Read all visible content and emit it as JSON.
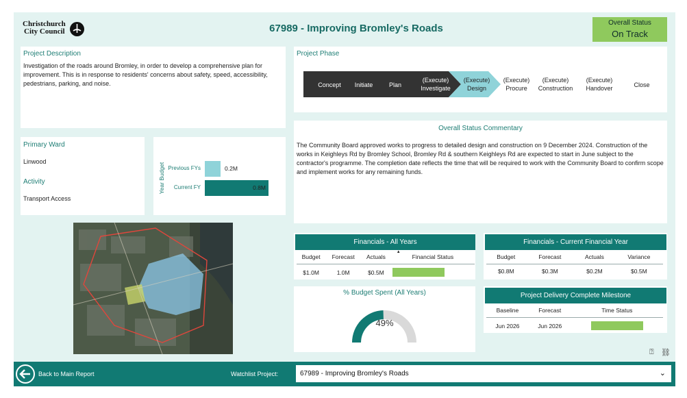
{
  "header": {
    "title": "67989 - Improving Bromley's Roads",
    "logo_line1": "Christchurch",
    "logo_line2": "City Council",
    "overall_status_label": "Overall Status",
    "overall_status_value": "On Track"
  },
  "description": {
    "label": "Project Description",
    "text": "Investigation of the roads around Bromley, in order to develop a comprehensive plan for improvement. This is in response to residents' concerns about safety, speed, accessibility, pedestrians, parking, and noise."
  },
  "phase": {
    "label": "Project Phase",
    "steps": [
      {
        "l1": "Concept",
        "l2": ""
      },
      {
        "l1": "Initiate",
        "l2": ""
      },
      {
        "l1": "Plan",
        "l2": ""
      },
      {
        "l1": "(Execute)",
        "l2": "Investigate"
      },
      {
        "l1": "(Execute)",
        "l2": "Design"
      },
      {
        "l1": "(Execute)",
        "l2": "Procure"
      },
      {
        "l1": "(Execute)",
        "l2": "Construction"
      },
      {
        "l1": "(Execute)",
        "l2": "Handover"
      },
      {
        "l1": "Close",
        "l2": ""
      }
    ]
  },
  "ward": {
    "label": "Primary Ward",
    "value": "Linwood",
    "activity_label": "Activity",
    "activity_value": "Transport Access"
  },
  "year_budget": {
    "axis_label": "Year Budget",
    "bars": [
      {
        "label": "Previous FYs",
        "value": 0.2,
        "text": "0.2M"
      },
      {
        "label": "Current FY",
        "value": 0.8,
        "text": "0.8M"
      }
    ]
  },
  "commentary": {
    "label": "Overall Status Commentary",
    "text": "The Community Board approved works to progress to detailed design and construction on 9 December 2024. Construction of the works in Keighleys Rd by Bromley School, Bromley Rd & southern Keighleys Rd are expected to start in June subject to the contractor's programme. The completion date reflects the time that will be required to work with the Community Board to confirm scope and implement works for any remaining funds."
  },
  "fin_all": {
    "title": "Financials - All Years",
    "headers": [
      "Budget",
      "Forecast",
      "Actuals",
      "Financial Status"
    ],
    "values": [
      "$1.0M",
      "1.0M",
      "$0.5M"
    ],
    "status_color": "#8fc95d"
  },
  "fin_current": {
    "title": "Financials - Current Financial Year",
    "headers": [
      "Budget",
      "Forecast",
      "Actuals",
      "Variance"
    ],
    "values": [
      "$0.8M",
      "$0.3M",
      "$0.2M",
      "$0.5M"
    ]
  },
  "budget_spent": {
    "title": "% Budget Spent (All Years)",
    "percent": 49,
    "text": "49%"
  },
  "milestone": {
    "title": "Project Delivery Complete Milestone",
    "headers": [
      "Baseline",
      "Forecast",
      "Time Status"
    ],
    "values": [
      "Jun 2026",
      "Jun 2026"
    ],
    "status_color": "#8fc95d"
  },
  "footer": {
    "back_label": "Back to Main Report",
    "watchlist_label": "Watchlist Project:",
    "watchlist_value": "67989 - Improving Bromley's Roads"
  },
  "colors": {
    "accent": "#117a73",
    "good": "#8fc95d",
    "phase_done": "#333333",
    "phase_current": "#8fd3d9"
  }
}
